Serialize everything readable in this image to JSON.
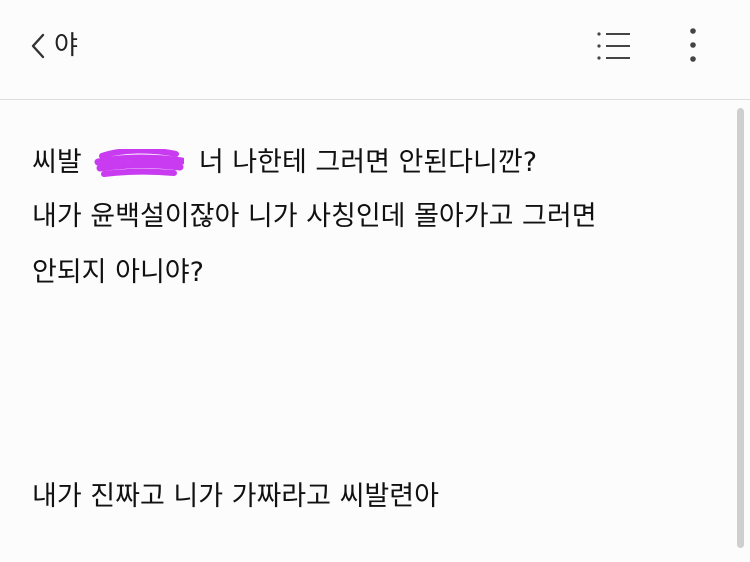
{
  "header": {
    "back_icon": "chevron-left-icon",
    "title": "야",
    "toc_icon": "list-icon",
    "more_icon": "more-vertical-icon"
  },
  "content": {
    "line1_prefix": "씨발",
    "line1_redaction_color": "#c93bf0",
    "line1_suffix": "너 나한테 그러면 안된다니깐?",
    "line2": "내가 윤백설이잖아 니가 사칭인데 몰아가고 그러면",
    "line3": "안되지 아니야?",
    "line4": "내가 진짜고 니가 가짜라고 씨발련아"
  },
  "colors": {
    "background": "#fcfcfc",
    "divider": "#dcdcdc",
    "text": "#111111",
    "scrollbar": "#cfcfcf"
  }
}
